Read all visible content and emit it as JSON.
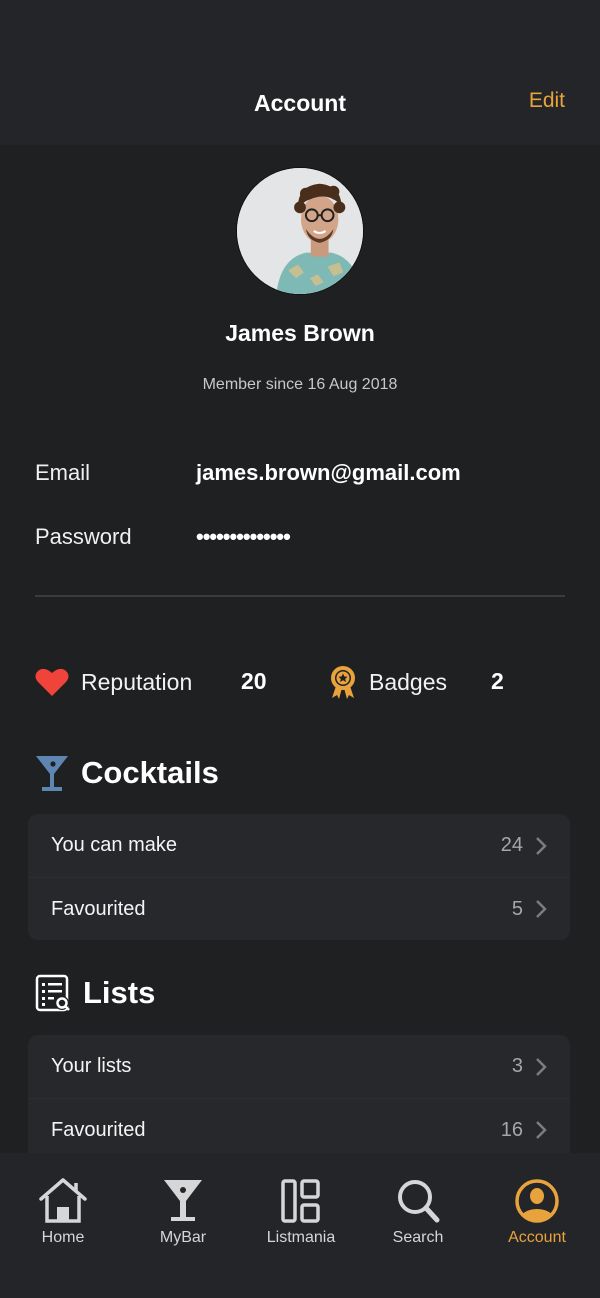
{
  "header": {
    "title": "Account",
    "edit_label": "Edit"
  },
  "profile": {
    "name": "James Brown",
    "member_since": "Member since 16 Aug 2018"
  },
  "fields": {
    "email_label": "Email",
    "email_value": "james.brown@gmail.com",
    "password_label": "Password",
    "password_value": "••••••••••••••"
  },
  "stats": {
    "reputation_label": "Reputation",
    "reputation_value": "20",
    "badges_label": "Badges",
    "badges_value": "2"
  },
  "cocktails": {
    "title": "Cocktails",
    "rows": [
      {
        "label": "You can make",
        "count": "24"
      },
      {
        "label": "Favourited",
        "count": "5"
      }
    ]
  },
  "lists": {
    "title": "Lists",
    "rows": [
      {
        "label": "Your lists",
        "count": "3"
      },
      {
        "label": "Favourited",
        "count": "16"
      }
    ]
  },
  "tabbar": {
    "tabs": [
      {
        "label": "Home",
        "icon": "home-icon"
      },
      {
        "label": "MyBar",
        "icon": "cocktail-glass-icon"
      },
      {
        "label": "Listmania",
        "icon": "layout-grid-icon"
      },
      {
        "label": "Search",
        "icon": "search-icon"
      },
      {
        "label": "Account",
        "icon": "account-icon",
        "active": true
      }
    ]
  },
  "colors": {
    "accent": "#e8a33d",
    "heart": "#f0433a",
    "glass": "#5f86b3",
    "background": "#1f2022",
    "header_bg": "#242528",
    "card_bg": "#27282b"
  }
}
